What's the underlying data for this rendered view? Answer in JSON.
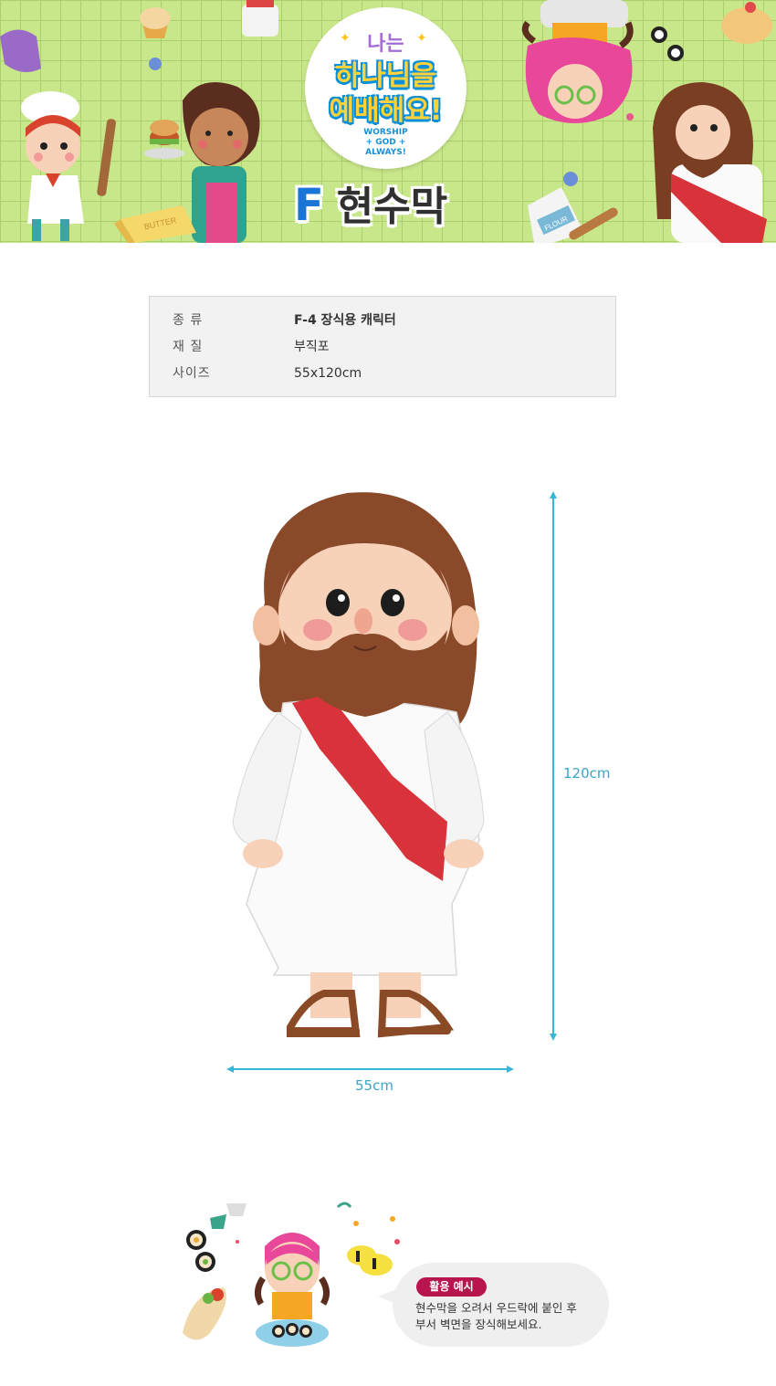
{
  "banner": {
    "logo": {
      "line1": "나는",
      "line2": "하나님을",
      "line3": "예배해요!",
      "english": [
        "WORSHIP",
        "+ GOD +",
        "ALWAYS!"
      ]
    },
    "title_letter": "F",
    "title_text": "현수막",
    "props": [
      "BUTTER",
      "FLOUR"
    ]
  },
  "spec": {
    "rows": [
      {
        "label": "종 류",
        "value": "F-4  장식용 캐릭터"
      },
      {
        "label": "재 질",
        "value": "부직포"
      },
      {
        "label": "사이즈",
        "value": "55x120cm"
      }
    ]
  },
  "dimensions": {
    "height": "120cm",
    "width": "55cm"
  },
  "usage": {
    "badge": "활용 예시",
    "lines": [
      "현수막을 오려서 우드락에 붙인 후",
      "부서 벽면을 장식해보세요."
    ]
  },
  "colors": {
    "banner_green": "#c8e68a",
    "measure_blue": "#39b6d6",
    "badge_red": "#b8144e",
    "sash_red": "#d8323a",
    "hair_brown": "#8a4a2a"
  }
}
